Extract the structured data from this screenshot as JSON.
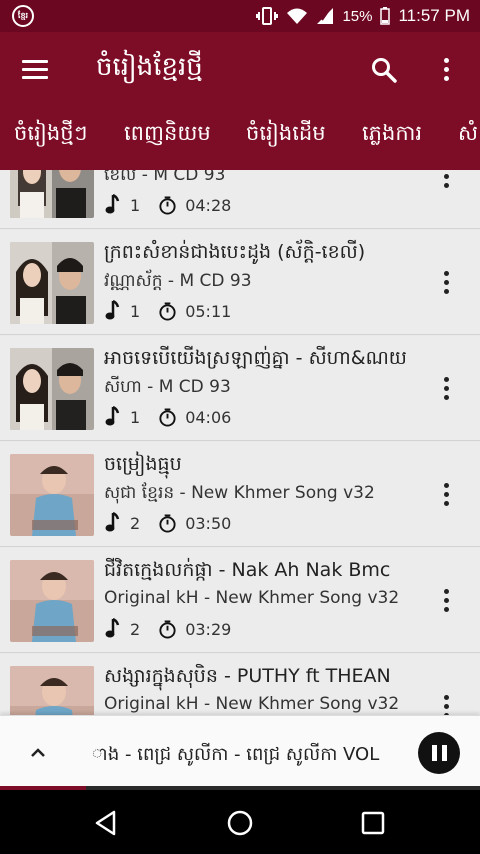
{
  "status_bar": {
    "app_icon_label": "ខ្មែរ",
    "battery": "15%",
    "time": "11:57 PM"
  },
  "app_bar": {
    "title": "ចំរៀងខ្មែរថ្មី",
    "icons": [
      "menu-icon",
      "search-icon",
      "more-vert-icon"
    ]
  },
  "tabs": [
    "ចំរៀងថ្មីៗ",
    "ពេញនិយម",
    "ចំរៀងដើម",
    "ភ្លេងការ",
    "សំ"
  ],
  "songs": [
    {
      "title": "",
      "subtitle": "ខេលី - M CD 93",
      "count": "1",
      "duration": "04:28"
    },
    {
      "title": "ក្រពះសំខាន់ជាងបេះដូង (ស័ក្តិ-ខេលី)",
      "subtitle": "វណ្ណាស័ក្ត - M CD 93",
      "count": "1",
      "duration": "05:11"
    },
    {
      "title": "អាចទេបើយើងស្រឡាញ់គ្នា - សីហា&ណយ",
      "subtitle": "សីហា - M CD 93",
      "count": "1",
      "duration": "04:06"
    },
    {
      "title": "ចម្រៀងធ្មុប",
      "subtitle": "សុជា ខ្មែរន - New Khmer Song v32",
      "count": "2",
      "duration": "03:50"
    },
    {
      "title": "ជីវិតក្មេងលក់ផ្កា - Nak Ah Nak Bmc",
      "subtitle": "Original kH - New Khmer Song v32",
      "count": "2",
      "duration": "03:29"
    },
    {
      "title": "សង្សារក្នុងសុបិន - PUTHY ft THEAN",
      "subtitle": "Original kH - New Khmer Song v32",
      "count": "",
      "duration": ""
    }
  ],
  "player": {
    "now_playing": "ាង - ពេជ្រ សូលីកា - ពេជ្រ សូលីកា VOL",
    "progress": 0.18
  },
  "colors": {
    "primary": "#7d0c26",
    "status": "#6b0720",
    "list_bg": "#ececec"
  }
}
